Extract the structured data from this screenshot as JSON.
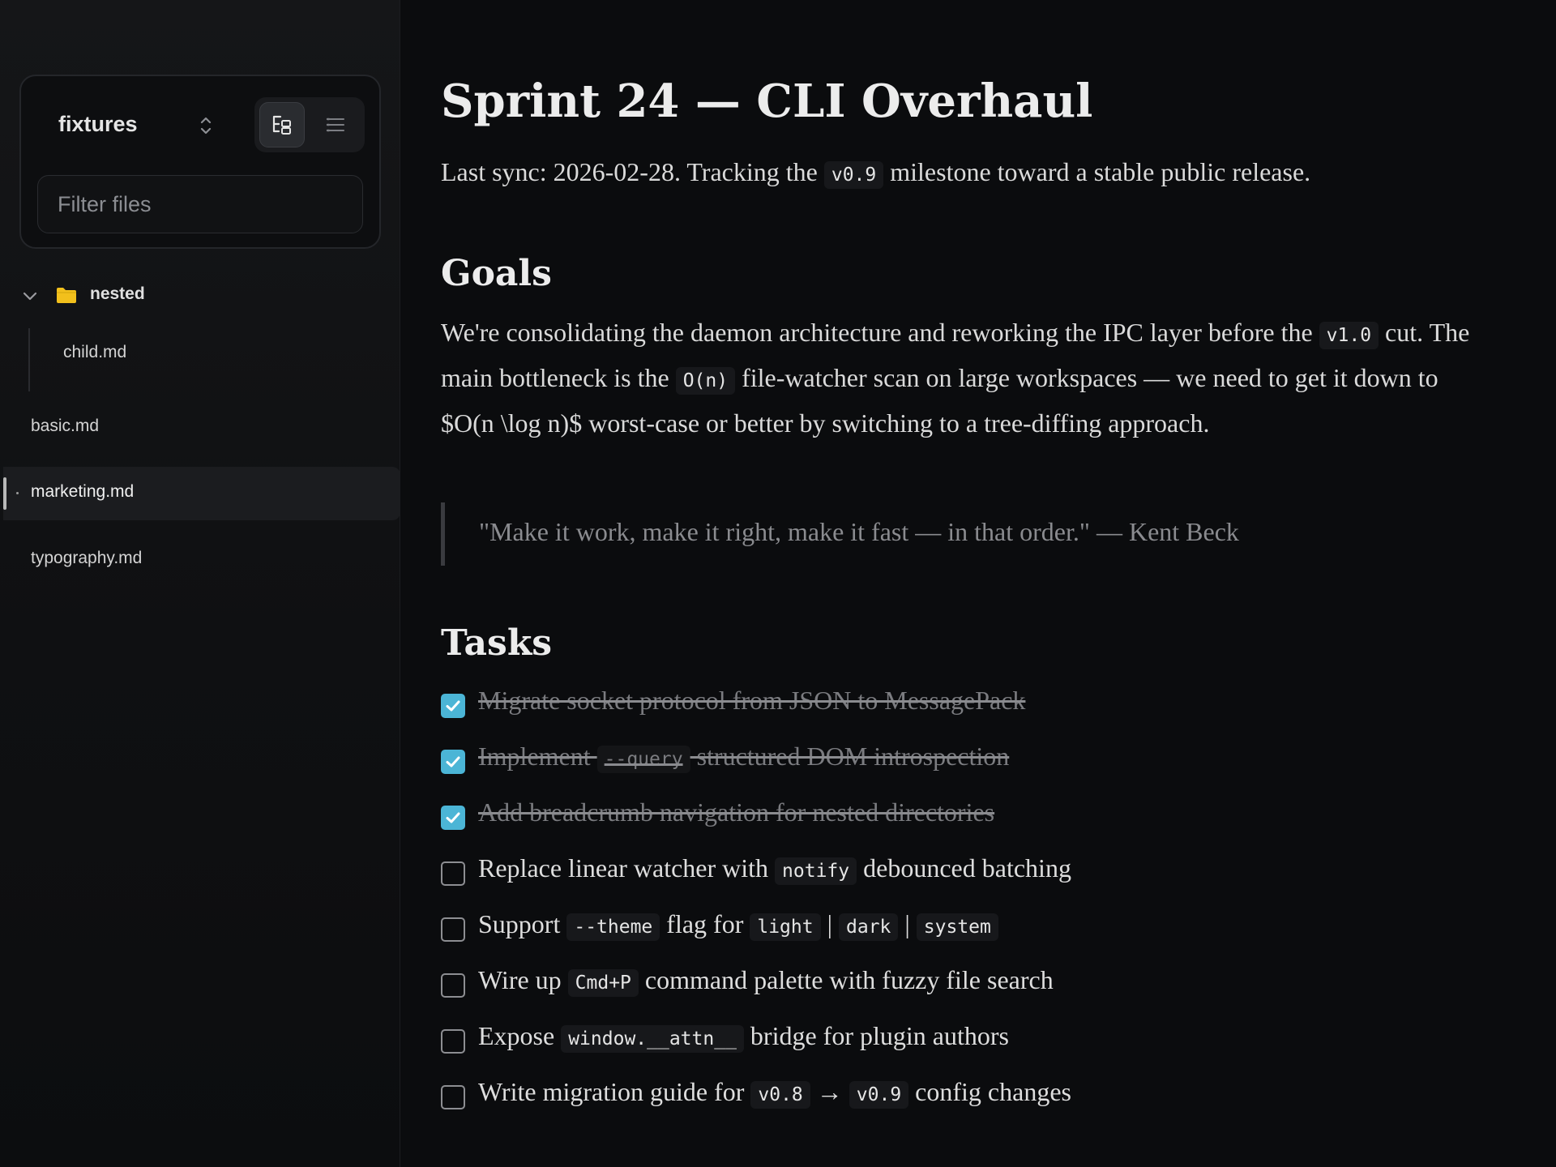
{
  "sidebar": {
    "workspace": "fixtures",
    "filter_placeholder": "Filter files",
    "folder": {
      "label": "nested",
      "expanded": true,
      "children": [
        "child.md"
      ]
    },
    "files": {
      "basic": "basic.md",
      "marketing": "marketing.md",
      "typography": "typography.md"
    },
    "active_file": "marketing.md"
  },
  "doc": {
    "title": "Sprint 24 — CLI Overhaul",
    "subtitle": {
      "pre": "Last sync: 2026-02-28. Tracking the ",
      "code": "v0.9",
      "post": " milestone toward a stable public release."
    },
    "goals": {
      "heading": "Goals",
      "p1": "We're consolidating the daemon architecture and reworking the IPC layer before the ",
      "code1": "v1.0",
      "p2": " cut. The main bottleneck is the ",
      "code2": "O(n)",
      "p3": " file-watcher scan on large workspaces — we need to get it down to $O(n \\log n)$ worst-case or better by switching to a tree-diffing approach."
    },
    "quote": "\"Make it work, make it right, make it fast — in that order.\" — Kent Beck",
    "tasks_heading": "Tasks",
    "tasks": [
      {
        "done": true,
        "text": "Migrate socket protocol from JSON to MessagePack"
      },
      {
        "done": true,
        "a": "Implement ",
        "code": "--query",
        "b": " structured DOM introspection"
      },
      {
        "done": true,
        "text": "Add breadcrumb navigation for nested directories"
      },
      {
        "done": false,
        "a": "Replace linear watcher with ",
        "code": "notify",
        "b": " debounced batching"
      },
      {
        "done": false,
        "a": "Support ",
        "c1": "--theme",
        "b": " flag for ",
        "c2": "light",
        "sep1": " | ",
        "c3": "dark",
        "sep2": " | ",
        "c4": "system"
      },
      {
        "done": false,
        "a": "Wire up ",
        "code": "Cmd+P",
        "b": " command palette with fuzzy file search"
      },
      {
        "done": false,
        "a": "Expose ",
        "code": "window.__attn__",
        "b": " bridge for plugin authors"
      },
      {
        "done": false,
        "a": "Write migration guide for ",
        "c1": "v0.8",
        "arrow": " → ",
        "c2": "v0.9",
        "b": " config changes"
      }
    ]
  },
  "colors": {
    "background": "#0b0c0e",
    "checkbox_checked": "#4bb5d6",
    "folder": "#f2c01c"
  }
}
